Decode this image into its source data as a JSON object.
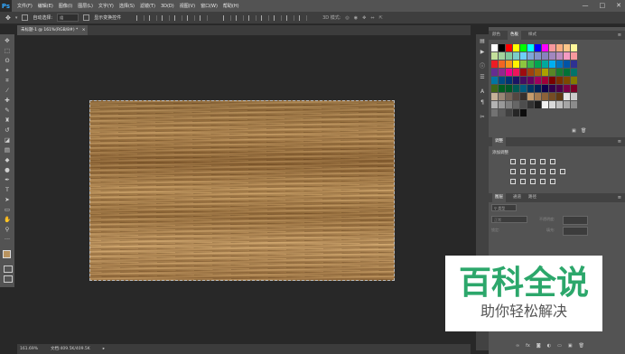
{
  "menubar": {
    "logo": "Ps",
    "items": [
      "文件(F)",
      "编辑(E)",
      "图像(I)",
      "图层(L)",
      "文字(Y)",
      "选择(S)",
      "滤镜(T)",
      "3D(D)",
      "视图(V)",
      "窗口(W)",
      "帮助(H)"
    ],
    "controls": [
      "—",
      "□",
      "✕"
    ]
  },
  "optionsbar": {
    "auto_select_label": "自动选择:",
    "auto_select_value": "组",
    "show_transform_label": "显示变换控件"
  },
  "document": {
    "tab_label": "未标题-1 @ 161%(RGB/8#) *",
    "tab_close": "×"
  },
  "status": {
    "zoom": "161.69%",
    "doc_size": "文档:409.5K/409.5K"
  },
  "panels": {
    "color_tabs": [
      "颜色",
      "色板",
      "样式"
    ],
    "adjust_tabs": [
      "调整"
    ],
    "adjust_add_label": "添加调整",
    "layer_tabs": [
      "图层",
      "通道",
      "路径"
    ],
    "blend_mode": "正常",
    "opacity_label": "不透明度:",
    "lock_label": "锁定:",
    "fill_label": "填充:",
    "layer_name": "背景",
    "filter_kind": "类型"
  },
  "swatch_colors": [
    "#ffffff",
    "#000000",
    "#ff0000",
    "#ffff00",
    "#00ff00",
    "#00ffff",
    "#0000ff",
    "#ff00ff",
    "#f6989d",
    "#f9ad81",
    "#fdc68a",
    "#fff79a",
    "#c4df9b",
    "#a3d39c",
    "#82ca9d",
    "#7bcdc8",
    "#6ecff6",
    "#7ea7d8",
    "#8493ca",
    "#8882be",
    "#a187be",
    "#bc8dbf",
    "#f49ac2",
    "#f6989d",
    "#ed1c24",
    "#f26522",
    "#f7941d",
    "#fff200",
    "#8dc63f",
    "#39b54a",
    "#00a651",
    "#00a99d",
    "#00aeef",
    "#0072bc",
    "#0054a6",
    "#2e3192",
    "#662d91",
    "#92278f",
    "#ec008c",
    "#ed145b",
    "#9e0b0f",
    "#a0410d",
    "#a36209",
    "#aba000",
    "#598527",
    "#1a7b30",
    "#007236",
    "#00746b",
    "#0076a3",
    "#004b80",
    "#003471",
    "#1b1464",
    "#440e62",
    "#630460",
    "#9e005d",
    "#9e0039",
    "#790000",
    "#7b2e00",
    "#7d4900",
    "#827b00",
    "#406618",
    "#005e20",
    "#005826",
    "#005952",
    "#005b7f",
    "#003663",
    "#002157",
    "#0d004c",
    "#32004b",
    "#4b0049",
    "#7b0046",
    "#7a0026",
    "#c7b299",
    "#998675",
    "#736357",
    "#534741",
    "#37302d",
    "#c69c6d",
    "#a67c52",
    "#8c6239",
    "#754c24",
    "#603913",
    "#e6e6e6",
    "#cccccc",
    "#b3b3b3",
    "#999999",
    "#808080",
    "#666666",
    "#4d4d4d",
    "#333333",
    "#1a1a1a",
    "#f2f2f2",
    "#d9d9d9",
    "#bfbfbf",
    "#a6a6a6",
    "#8c8c8c",
    "#737373",
    "#595959",
    "#404040",
    "#262626",
    "#0d0d0d"
  ],
  "icons": {
    "move": "✥",
    "marquee": "⬚",
    "lasso": "ʘ",
    "wand": "✦",
    "crop": "⌗",
    "eyedropper": "⁄",
    "heal": "✚",
    "brush": "✎",
    "stamp": "♜",
    "history": "↺",
    "eraser": "◪",
    "gradient": "▤",
    "blur": "◆",
    "dodge": "●",
    "pen": "✒",
    "text": "T",
    "select": "➤",
    "shape": "▭",
    "hand": "✋",
    "zoom": "⚲",
    "more": "···"
  },
  "watermark": {
    "title": "百科全说",
    "subtitle": "助你轻松解决"
  }
}
